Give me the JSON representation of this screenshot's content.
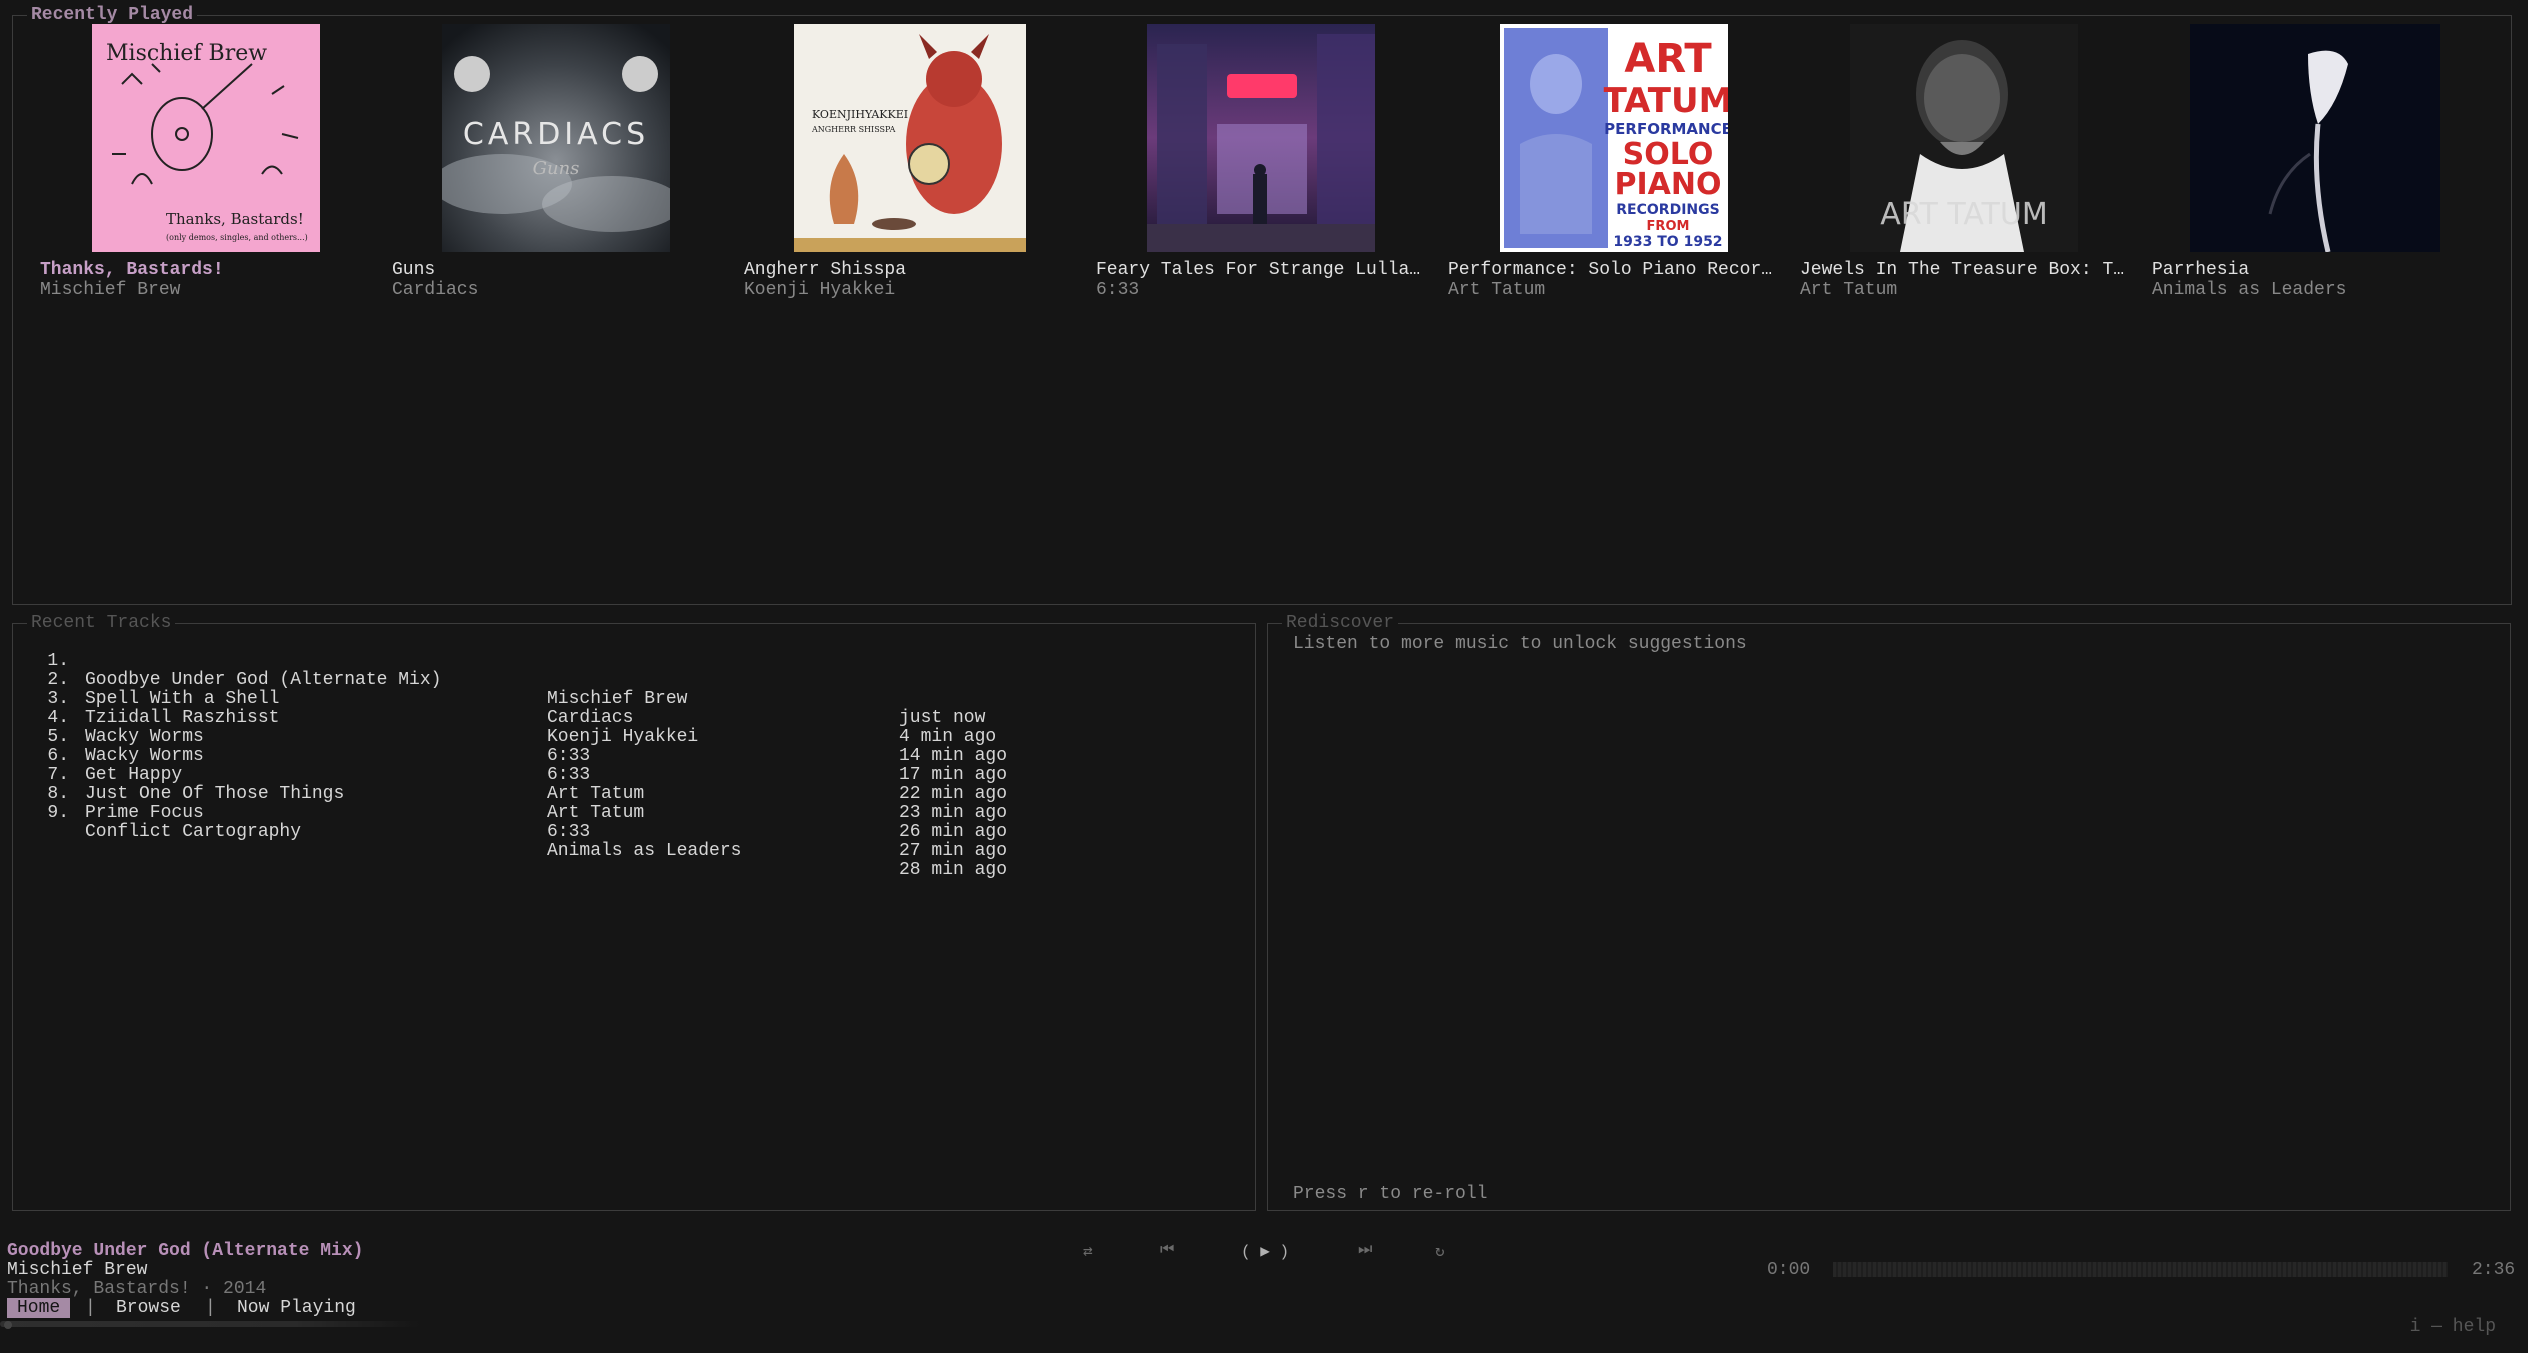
{
  "recently_played": {
    "title": "Recently Played",
    "albums": [
      {
        "title": "Thanks, Bastards!",
        "subtitle": "Mischief Brew",
        "cover_text": "Mischief Brew",
        "cover_text2": "Thanks, Bastards!",
        "cover_text3": "(only demos, singles, and others...)"
      },
      {
        "title": "Guns",
        "subtitle": "Cardiacs",
        "cover_text": "CARDIACS",
        "cover_text2": "Guns"
      },
      {
        "title": "Angherr Shisspa",
        "subtitle": "Koenji Hyakkei",
        "cover_text": "KOENJIHYAKKEI",
        "cover_text2": "ANGHERR SHISSPA"
      },
      {
        "title": "Feary Tales For Strange Lulla…",
        "subtitle": "6:33"
      },
      {
        "title": "Performance: Solo Piano Recor…",
        "subtitle": "Art Tatum",
        "cover_text": "ART",
        "cover_text2": "TATUM",
        "cover_text3": "PERFORMANCE",
        "cover_text4": "SOLO",
        "cover_text5": "PIANO",
        "cover_text6": "RECORDINGS",
        "cover_text7": "FROM",
        "cover_text8": "1933 TO 1952"
      },
      {
        "title": "Jewels In The Treasure Box: T…",
        "subtitle": "Art Tatum",
        "cover_text": "ART TATUM"
      },
      {
        "title": "Parrhesia",
        "subtitle": "Animals as Leaders"
      }
    ]
  },
  "recent_tracks": {
    "title": "Recent Tracks",
    "rows": [
      {
        "num": "1.",
        "title": "Goodbye Under God (Alternate Mix)",
        "artist": "Mischief Brew",
        "time": "just now"
      },
      {
        "num": "2.",
        "title": "Spell With a Shell",
        "artist": "Cardiacs",
        "time": "4 min ago"
      },
      {
        "num": "3.",
        "title": "Tziidall Raszhisst",
        "artist": "Koenji Hyakkei",
        "time": "14 min ago"
      },
      {
        "num": "4.",
        "title": "Wacky Worms",
        "artist": "6:33",
        "time": "17 min ago"
      },
      {
        "num": "5.",
        "title": "Wacky Worms",
        "artist": "6:33",
        "time": "22 min ago"
      },
      {
        "num": "6.",
        "title": "Get Happy",
        "artist": "Art Tatum",
        "time": "23 min ago"
      },
      {
        "num": "7.",
        "title": "Just One Of Those Things",
        "artist": "Art Tatum",
        "time": "26 min ago"
      },
      {
        "num": "8.",
        "title": "Prime Focus",
        "artist": "6:33",
        "time": "27 min ago"
      },
      {
        "num": "9.",
        "title": "Conflict Cartography",
        "artist": "Animals as Leaders",
        "time": "28 min ago"
      }
    ]
  },
  "rediscover": {
    "title": "Rediscover",
    "message": "Listen to more music to unlock suggestions",
    "hint": "Press r to re-roll"
  },
  "now_playing": {
    "title": "Goodbye Under God (Alternate Mix)",
    "artist": "Mischief Brew",
    "album_line": "Thanks, Bastards! · 2014",
    "elapsed": "0:00",
    "duration": "2:36",
    "progress": 0
  },
  "controls": {
    "shuffle": "⇄",
    "prev": "⏮",
    "play": "( ▶ )",
    "next": "⏭",
    "repeat": "↻"
  },
  "tabs": [
    {
      "label": "Home",
      "active": true
    },
    {
      "label": "Browse",
      "active": false
    },
    {
      "label": "Now Playing",
      "active": false
    }
  ],
  "tab_separator": "|",
  "help_hint": "i — help",
  "colors": {
    "accent": "#a58aa5",
    "background": "#151515",
    "border": "#3c3c3c"
  }
}
